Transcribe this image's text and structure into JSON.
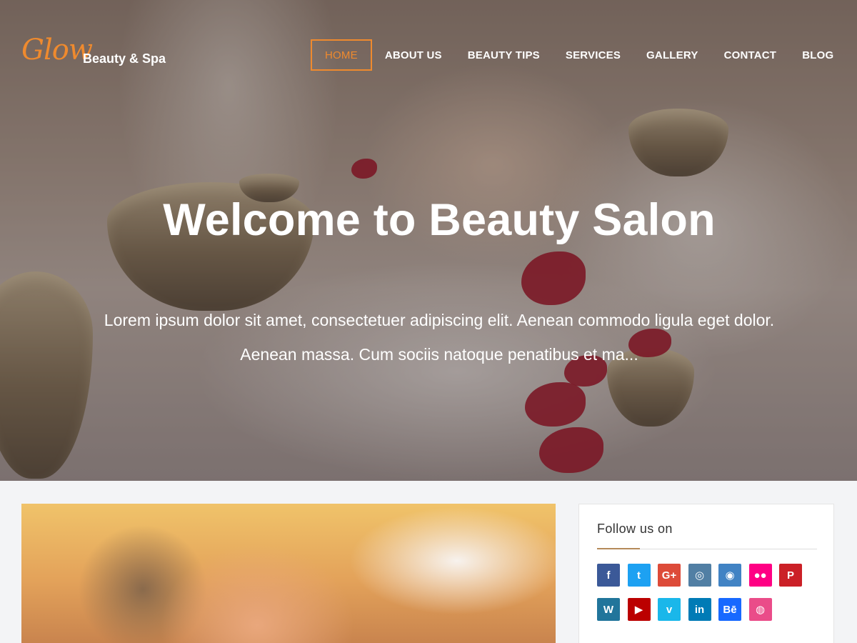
{
  "brand": {
    "logo_text": "Glow",
    "tagline": "Beauty & Spa"
  },
  "nav": {
    "items": [
      {
        "label": "HOME",
        "active": true
      },
      {
        "label": "ABOUT US"
      },
      {
        "label": "BEAUTY TIPS"
      },
      {
        "label": "SERVICES"
      },
      {
        "label": "GALLERY"
      },
      {
        "label": "CONTACT"
      },
      {
        "label": "BLOG"
      }
    ]
  },
  "hero": {
    "title": "Welcome to Beauty Salon",
    "subtitle_line1": "Lorem ipsum dolor sit amet, consectetuer adipiscing elit. Aenean commodo ligula eget dolor.",
    "subtitle_line2": "Aenean massa. Cum sociis natoque penatibus et ma..."
  },
  "sidebar": {
    "title": "Follow us on",
    "social": [
      {
        "name": "facebook",
        "glyph": "f",
        "color": "#3b5998"
      },
      {
        "name": "twitter",
        "glyph": "t",
        "color": "#1da1f2"
      },
      {
        "name": "google-plus",
        "glyph": "G+",
        "color": "#dd4b39"
      },
      {
        "name": "instagram",
        "glyph": "◎",
        "color": "#517fa4"
      },
      {
        "name": "github",
        "glyph": "◉",
        "color": "#4183c4"
      },
      {
        "name": "flickr",
        "glyph": "●●",
        "color": "#ff0084"
      },
      {
        "name": "pinterest",
        "glyph": "P",
        "color": "#cb2027"
      },
      {
        "name": "wordpress",
        "glyph": "W",
        "color": "#21759b"
      },
      {
        "name": "youtube",
        "glyph": "▶",
        "color": "#bb0000"
      },
      {
        "name": "vimeo",
        "glyph": "v",
        "color": "#1ab7ea"
      },
      {
        "name": "linkedin",
        "glyph": "in",
        "color": "#007bb6"
      },
      {
        "name": "behance",
        "glyph": "Bē",
        "color": "#1769ff"
      },
      {
        "name": "dribbble",
        "glyph": "◍",
        "color": "#ea4c89"
      }
    ]
  },
  "colors": {
    "accent": "#ef8a2e",
    "page_bg": "#f3f4f6"
  }
}
